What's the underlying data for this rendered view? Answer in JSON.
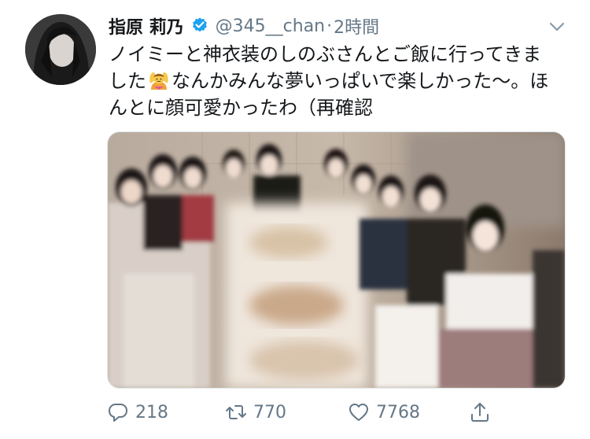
{
  "tweet": {
    "display_name": "指原 莉乃",
    "handle": "@345__chan",
    "separator": "·",
    "time": "2時間",
    "text_line1": "ノイミーと神衣装のしのぶさんとご飯に行ってきま",
    "text_line2_a": "した",
    "text_line2_b": "なんかみんな夢いっぱいで楽しかった〜。ほ",
    "text_line3": "んとに顔可愛かったわ（再確認"
  },
  "icons": {
    "verified": "verified-badge-icon",
    "menu": "chevron-down-icon",
    "emoji": "person-gesturing-ok-emoji-icon",
    "reply": "reply-icon",
    "retweet": "retweet-icon",
    "like": "like-heart-icon",
    "share": "share-icon"
  },
  "actions": {
    "reply_count": "218",
    "retweet_count": "770",
    "like_count": "7768"
  },
  "colors": {
    "accent": "#1da1f2",
    "text": "#14171a",
    "secondary": "#657786"
  }
}
